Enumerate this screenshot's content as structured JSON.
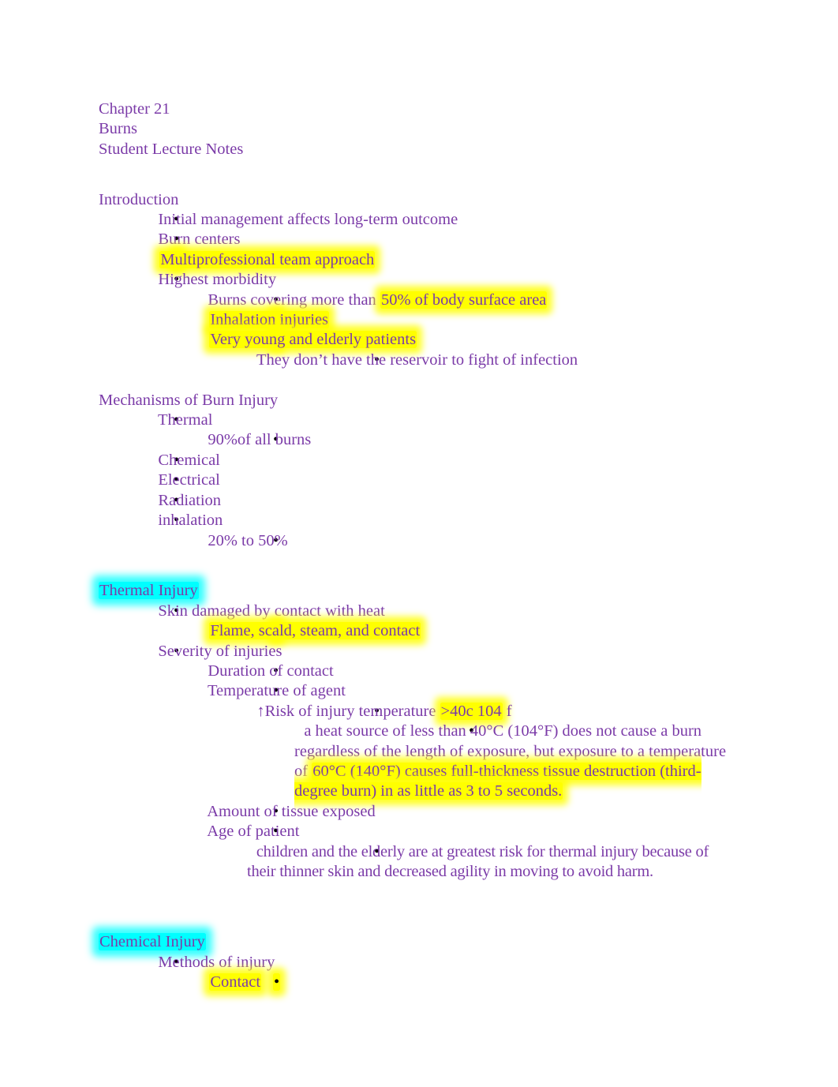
{
  "document": {
    "title_block": {
      "chapter": "Chapter 21",
      "topic": "Burns",
      "subtitle": "Student Lecture Notes"
    },
    "colors": {
      "text_purple": "#7b3ba8",
      "highlight_yellow": "#ffff00",
      "highlight_cyan": "#00ffff",
      "bullet_black": "#000000",
      "page_background": "#ffffff"
    },
    "bullet_glyph": "•",
    "sections": [
      {
        "heading": "Introduction",
        "heading_highlight": "none",
        "items": [
          {
            "level": 1,
            "text": "Initial management affects long-term outcome",
            "highlight": "none"
          },
          {
            "level": 1,
            "text": "Burn centers",
            "highlight": "none"
          },
          {
            "level": 1,
            "text": "Multiprofessional team approach",
            "highlight": "yellow-full"
          },
          {
            "level": 1,
            "text": "Highest morbidity",
            "highlight": "none"
          },
          {
            "level": 2,
            "text": "Burns covering more than ",
            "text_highlight": "50% of body surface area",
            "highlight": "yellow-partial"
          },
          {
            "level": 2,
            "text": "Inhalation injuries",
            "highlight": "yellow-full"
          },
          {
            "level": 2,
            "text": "Very young and elderly patients",
            "highlight": "yellow-full"
          },
          {
            "level": 3,
            "text": "They don’t have the reservoir to fight of infection",
            "highlight": "none"
          }
        ]
      },
      {
        "heading": "Mechanisms of Burn Injury",
        "heading_highlight": "none",
        "items": [
          {
            "level": 1,
            "text": "Thermal",
            "highlight": "none"
          },
          {
            "level": 2,
            "text": "90%of all burns",
            "highlight": "none"
          },
          {
            "level": 1,
            "text": "Chemical",
            "highlight": "none"
          },
          {
            "level": 1,
            "text": "Electrical",
            "highlight": "none"
          },
          {
            "level": 1,
            "text": "Radiation",
            "highlight": "none"
          },
          {
            "level": 1,
            "text": "inhalation",
            "highlight": "none"
          },
          {
            "level": 2,
            "text": "20% to 50%",
            "highlight": "none"
          }
        ]
      },
      {
        "heading": "Thermal Injury",
        "heading_highlight": "cyan",
        "items": [
          {
            "level": 1,
            "text": "Skin damaged by contact with heat",
            "highlight": "none"
          },
          {
            "level": 2,
            "text": "Flame, scald, steam, and contact",
            "highlight": "yellow-full"
          },
          {
            "level": 1,
            "text": "Severity of injuries",
            "highlight": "none"
          },
          {
            "level": 2,
            "text": "Duration of contact",
            "highlight": "none"
          },
          {
            "level": 2,
            "text": "Temperature of agent",
            "highlight": "none"
          },
          {
            "level": 3,
            "text": "↑Risk of injury temperature  ",
            "text_highlight": ">40c 104",
            "text_tail": " f",
            "highlight": "yellow-partial"
          },
          {
            "level": 4,
            "text": "a heat source of less than 40°C (104°F) does not cause a burn regardless of the length of exposure, but exposure to a temperature of  ",
            "text_highlight": "60°C (140°F) causes full-thickness tissue destruction (third-degree burn) in as little as 3 to 5 seconds.",
            "highlight": "yellow-partial"
          },
          {
            "level": 2,
            "text": "Amount of tissue exposed",
            "highlight": "none"
          },
          {
            "level": 2,
            "text": "Age of patient",
            "highlight": "none"
          },
          {
            "level": 3,
            "text": "children and the elderly are at greatest risk for thermal injury because of their thinner skin and decreased agility in moving to avoid harm.",
            "highlight": "none",
            "style": "condensed"
          }
        ]
      },
      {
        "heading": "Chemical Injury",
        "heading_highlight": "cyan",
        "items": [
          {
            "level": 1,
            "text": "Methods of injury",
            "highlight": "none"
          },
          {
            "level": 2,
            "text": "Contact",
            "highlight": "yellow-full"
          }
        ]
      }
    ]
  }
}
